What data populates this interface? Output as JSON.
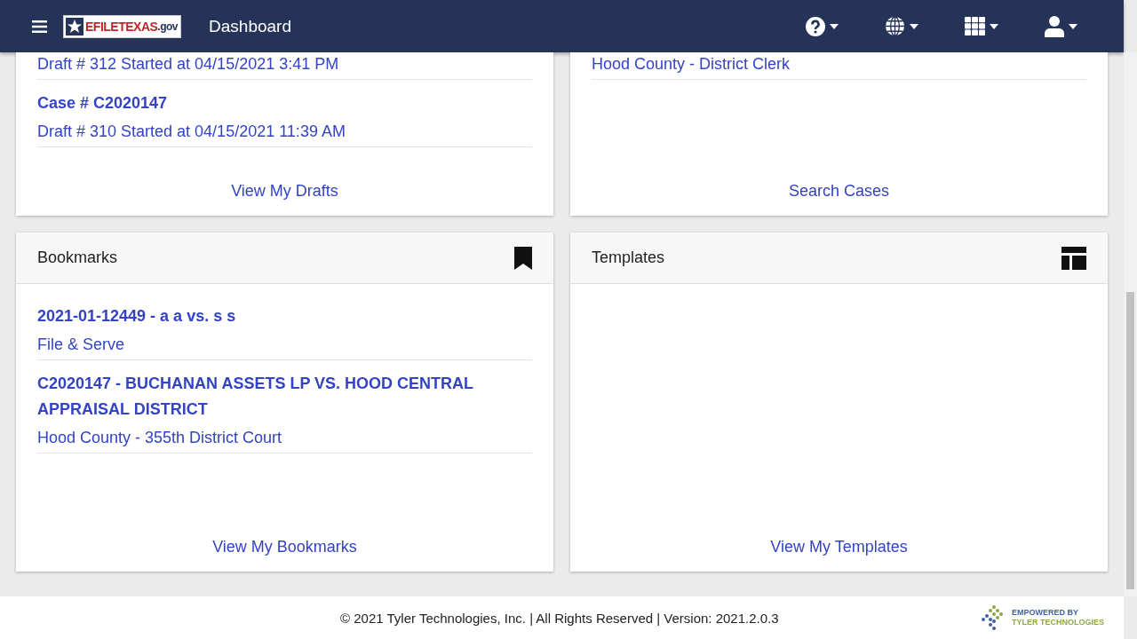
{
  "header": {
    "title": "Dashboard",
    "logo": {
      "prefix": "EFILE",
      "main": "TEXAS",
      "suffix": ".gov"
    }
  },
  "top_cards": [
    {
      "items": [
        {
          "subtitle": "Draft # 312 Started at 04/15/2021 3:41 PM"
        },
        {
          "title": "Case # C2020147",
          "subtitle": "Draft # 310 Started at 04/15/2021 11:39 AM"
        }
      ],
      "footer_link": "View My Drafts"
    },
    {
      "items": [
        {
          "subtitle": "Hood County - District Clerk"
        }
      ],
      "footer_link": "Search Cases"
    }
  ],
  "cards": [
    {
      "title": "Bookmarks",
      "kind": "bookmark",
      "items": [
        {
          "title": "2021-01-12449 - a a vs. s s",
          "subtitle": "File & Serve"
        },
        {
          "title": "C2020147 - BUCHANAN ASSETS LP VS. HOOD CENTRAL APPRAISAL DISTRICT",
          "subtitle": "Hood County - 355th District Court"
        }
      ],
      "footer_link": "View My Bookmarks"
    },
    {
      "title": "Templates",
      "kind": "template",
      "footer_link": "View My Templates"
    }
  ],
  "footer": {
    "copyright": "© 2021 Tyler Technologies, Inc. | All Rights Reserved | Version: 2021.2.0.3",
    "badge_line_1": "EMPOWERED BY",
    "badge_line_2": "TYLER TECHNOLOGIES"
  }
}
